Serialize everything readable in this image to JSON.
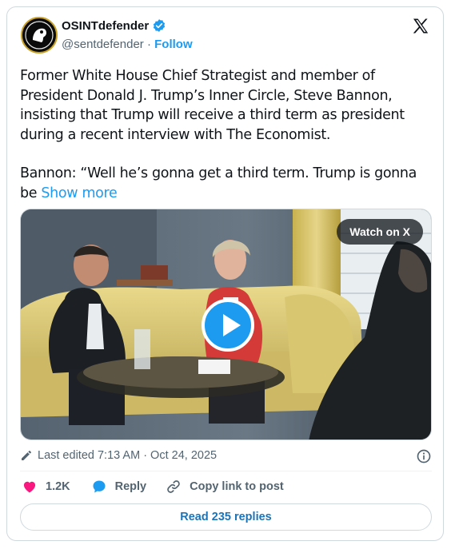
{
  "author": {
    "display_name": "OSINTdefender",
    "handle": "@sentdefender",
    "separator": "·",
    "follow_label": "Follow"
  },
  "tweet": {
    "paragraph1": "Former White House Chief Strategist and member of President Donald J. Trump’s Inner Circle, Steve Bannon, insisting that Trump will receive a third term as president during a recent interview with The Economist.",
    "paragraph2": "Bannon: “Well he’s gonna get a third term. Trump is gonna be",
    "show_more_label": "Show more"
  },
  "media": {
    "watch_label": "Watch on X"
  },
  "meta": {
    "edited_text": "Last edited 7:13 AM · Oct 24, 2025"
  },
  "actions": {
    "likes_count": "1.2K",
    "reply_label": "Reply",
    "copy_link_label": "Copy link to post"
  },
  "replies_button_label": "Read 235 replies",
  "colors": {
    "accent": "#1d9bf0",
    "like": "#f91880",
    "muted_text": "#536471",
    "verified_badge": "#1d9bf0"
  },
  "icons": [
    "verified-badge-icon",
    "x-logo-icon",
    "play-icon",
    "pencil-icon",
    "info-icon",
    "heart-icon",
    "reply-bubble-icon",
    "link-icon"
  ]
}
